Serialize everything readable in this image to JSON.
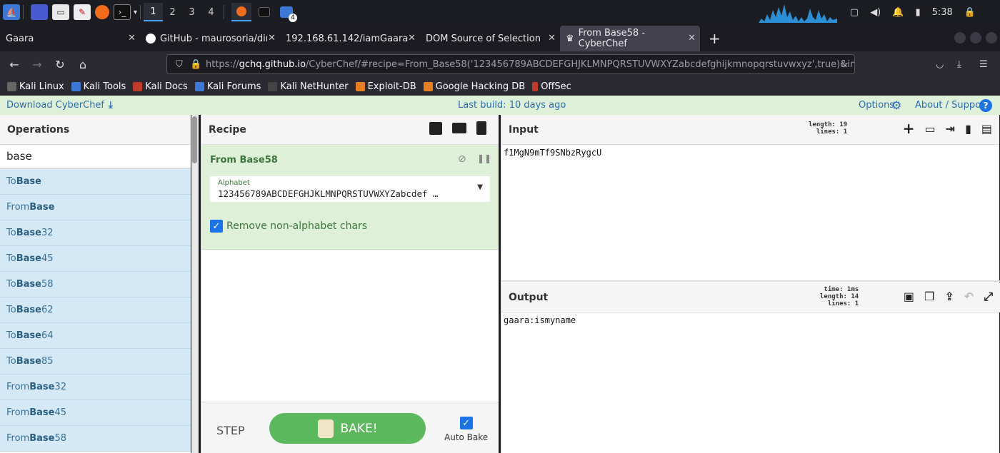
{
  "taskbar": {
    "workspaces": [
      "1",
      "2",
      "3",
      "4"
    ],
    "notifications_badge": "4",
    "clock": "5:38"
  },
  "tabs": [
    {
      "label": "Gaara"
    },
    {
      "label": "GitHub - maurosoria/dirs"
    },
    {
      "label": "192.168.61.142/iamGaara"
    },
    {
      "label": "DOM Source of Selection"
    },
    {
      "label": "From Base58 - CyberChef"
    }
  ],
  "new_tab_label": "+",
  "url": {
    "prefix": "https://",
    "host": "gchq.github.io",
    "rest": "/CyberChef/#recipe=From_Base58('123456789ABCDEFGHJKLMNPQRSTUVWXYZabcdefghijkmnopqrstuvwxyz',true)&input=Z"
  },
  "bookmarks": [
    "Kali Linux",
    "Kali Tools",
    "Kali Docs",
    "Kali Forums",
    "Kali NetHunter",
    "Exploit-DB",
    "Google Hacking DB",
    "OffSec"
  ],
  "cyberchef": {
    "download_label": "Download CyberChef",
    "last_build": "Last build: 10 days ago",
    "options_label": "Options",
    "about_label": "About / Support"
  },
  "operations": {
    "heading": "Operations",
    "search_value": "base",
    "items": [
      {
        "prefix": "To ",
        "match": "Base",
        "suffix": ""
      },
      {
        "prefix": "From ",
        "match": "Base",
        "suffix": ""
      },
      {
        "prefix": "To ",
        "match": "Base",
        "suffix": "32"
      },
      {
        "prefix": "To ",
        "match": "Base",
        "suffix": "45"
      },
      {
        "prefix": "To ",
        "match": "Base",
        "suffix": "58"
      },
      {
        "prefix": "To ",
        "match": "Base",
        "suffix": "62"
      },
      {
        "prefix": "To ",
        "match": "Base",
        "suffix": "64"
      },
      {
        "prefix": "To ",
        "match": "Base",
        "suffix": "85"
      },
      {
        "prefix": "From ",
        "match": "Base",
        "suffix": "32"
      },
      {
        "prefix": "From ",
        "match": "Base",
        "suffix": "45"
      },
      {
        "prefix": "From ",
        "match": "Base",
        "suffix": "58"
      }
    ]
  },
  "recipe": {
    "heading": "Recipe",
    "operation_title": "From Base58",
    "alphabet_label": "Alphabet",
    "alphabet_value": "123456789ABCDEFGHJKLMNPQRSTUVWXYZabcdef …",
    "remove_nonalpha_label": "Remove non-alphabet chars",
    "remove_nonalpha_checked": true,
    "step_label": "STEP",
    "bake_label": "BAKE!",
    "auto_bake_label": "Auto Bake"
  },
  "input": {
    "heading": "Input",
    "length_line": "length: 19",
    "lines_line": "lines:  1",
    "value": "f1MgN9mTf9SNbzRygcU"
  },
  "output": {
    "heading": "Output",
    "time_line": "time:  1ms",
    "length_line": "length:  14",
    "lines_line": "lines:   1",
    "value": "gaara:ismyname"
  }
}
